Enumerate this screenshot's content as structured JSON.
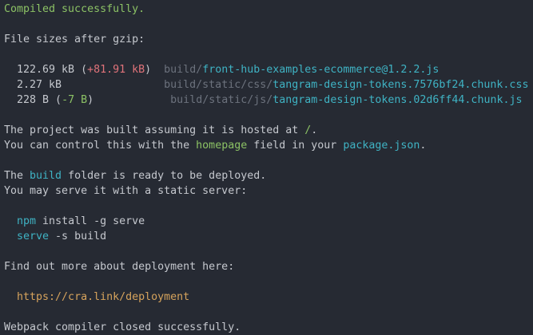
{
  "colors": {
    "background": "#262a33",
    "default": "#c5c8ce",
    "green": "#8cc265",
    "cyan": "#3fb3c4",
    "red": "#e0737a",
    "dim": "#6c727d",
    "orange": "#d6a35c"
  },
  "lines": [
    [
      {
        "t": "Compiled successfully.",
        "c": "green"
      }
    ],
    [],
    [
      {
        "t": "File sizes after gzip:",
        "c": "default"
      }
    ],
    [],
    [
      {
        "t": "  122.69 kB (",
        "c": "default"
      },
      {
        "t": "+81.91 kB",
        "c": "red"
      },
      {
        "t": ")  ",
        "c": "default"
      },
      {
        "t": "build/",
        "c": "dim"
      },
      {
        "t": "front-hub-examples-ecommerce@1.2.2.js",
        "c": "cyan"
      }
    ],
    [
      {
        "t": "  2.27 kB                ",
        "c": "default"
      },
      {
        "t": "build/static/css/",
        "c": "dim"
      },
      {
        "t": "tangram-design-tokens.7576bf24.chunk.css",
        "c": "cyan"
      }
    ],
    [
      {
        "t": "  228 B (",
        "c": "default"
      },
      {
        "t": "-7 B",
        "c": "green"
      },
      {
        "t": ")            ",
        "c": "default"
      },
      {
        "t": "build/static/js/",
        "c": "dim"
      },
      {
        "t": "tangram-design-tokens.02d6ff44.chunk.js",
        "c": "cyan"
      }
    ],
    [],
    [
      {
        "t": "The project was built assuming it is hosted at ",
        "c": "default"
      },
      {
        "t": "/",
        "c": "green"
      },
      {
        "t": ".",
        "c": "default"
      }
    ],
    [
      {
        "t": "You can control this with the ",
        "c": "default"
      },
      {
        "t": "homepage",
        "c": "green"
      },
      {
        "t": " field in your ",
        "c": "default"
      },
      {
        "t": "package.json",
        "c": "cyan"
      },
      {
        "t": ".",
        "c": "default"
      }
    ],
    [],
    [
      {
        "t": "The ",
        "c": "default"
      },
      {
        "t": "build",
        "c": "cyan"
      },
      {
        "t": " folder is ready to be deployed.",
        "c": "default"
      }
    ],
    [
      {
        "t": "You may serve it with a static server:",
        "c": "default"
      }
    ],
    [],
    [
      {
        "t": "  ",
        "c": "default"
      },
      {
        "t": "npm",
        "c": "cyan"
      },
      {
        "t": " install -g serve",
        "c": "default"
      }
    ],
    [
      {
        "t": "  ",
        "c": "default"
      },
      {
        "t": "serve",
        "c": "cyan"
      },
      {
        "t": " -s build",
        "c": "default"
      }
    ],
    [],
    [
      {
        "t": "Find out more about deployment here:",
        "c": "default"
      }
    ],
    [],
    [
      {
        "t": "  ",
        "c": "default"
      },
      {
        "t": "https://cra.link/deployment",
        "c": "orange"
      }
    ],
    [],
    [
      {
        "t": "Webpack compiler closed successfully.",
        "c": "default"
      }
    ]
  ]
}
